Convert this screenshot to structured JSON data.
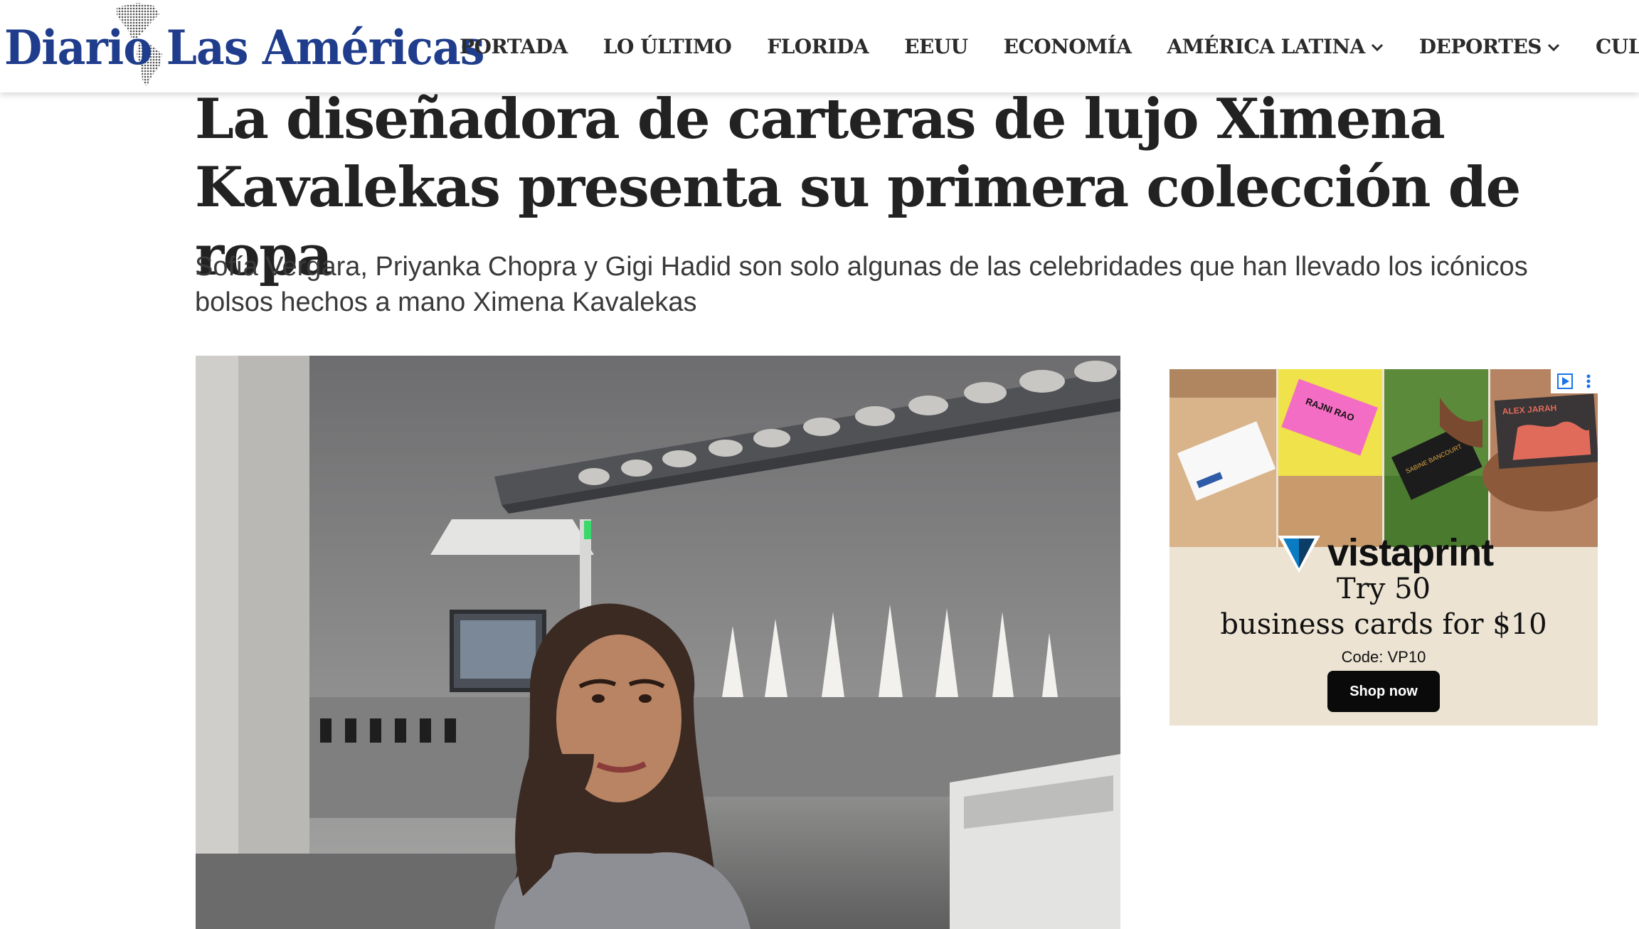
{
  "site": {
    "logo_text": "Diario Las Américas"
  },
  "nav": {
    "items": [
      {
        "label": "PORTADA",
        "dropdown": false
      },
      {
        "label": "LO ÚLTIMO",
        "dropdown": false
      },
      {
        "label": "FLORIDA",
        "dropdown": false
      },
      {
        "label": "EEUU",
        "dropdown": false
      },
      {
        "label": "ECONOMÍA",
        "dropdown": false
      },
      {
        "label": "AMÉRICA LATINA",
        "dropdown": true
      },
      {
        "label": "DEPORTES",
        "dropdown": true
      },
      {
        "label": "CULTURA",
        "dropdown": true
      }
    ]
  },
  "article": {
    "headline": "La diseñadora de carteras de lujo Ximena Kavalekas presenta su primera colección de ropa",
    "subheadline": "Sofía Vergara, Priyanka Chopra y Gigi Hadid son solo algunas de las celebridades que han llevado los icónicos bolsos hechos a mano Ximena Kavalekas"
  },
  "ad": {
    "brand": "vistaprint",
    "line1": "Try 50",
    "line2": "business cards for $10",
    "code": "Code: VP10",
    "cta": "Shop now",
    "card_names": [
      "RAJNI RAO",
      "SABINE BANCOURT",
      "ALEX JARAH"
    ]
  },
  "colors": {
    "logo_blue": "#1f3d8c",
    "headline_text": "#222222",
    "ad_background": "#ece3d3",
    "cta_background": "#0a0a0a"
  }
}
